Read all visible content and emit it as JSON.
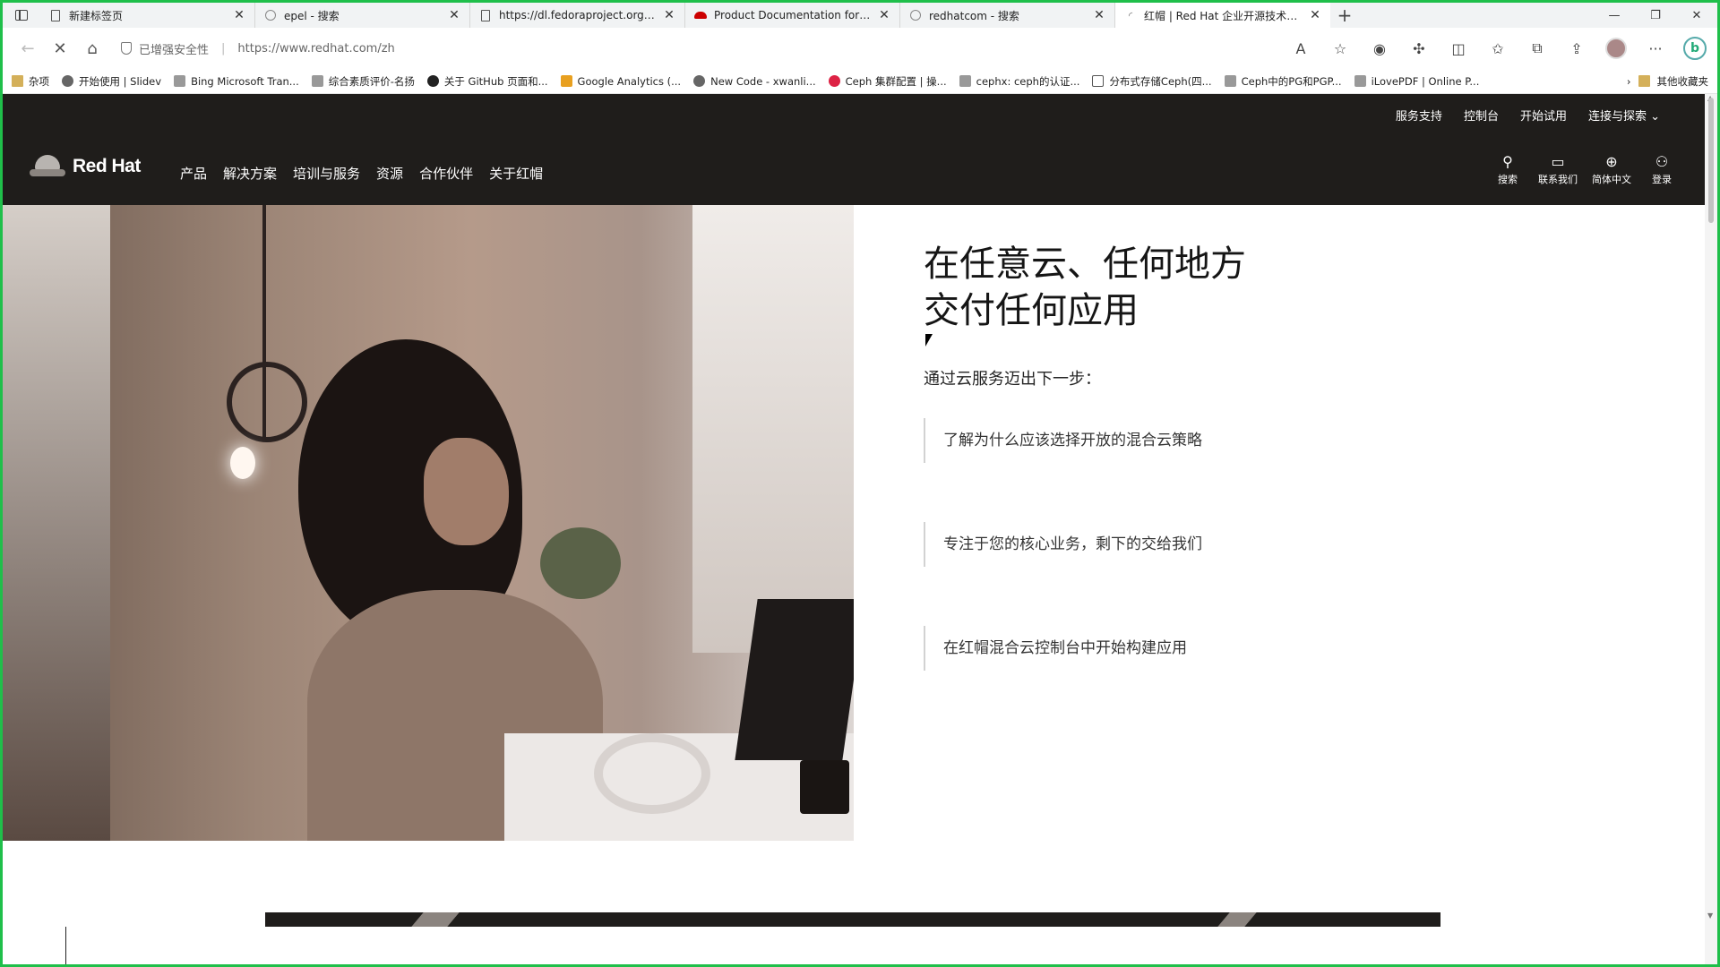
{
  "browser": {
    "tabs": [
      {
        "title": "新建标签页",
        "favicon": "new-tab-icon",
        "active": false
      },
      {
        "title": "epel - 搜索",
        "favicon": "bing-icon",
        "active": false
      },
      {
        "title": "https://dl.fedoraproject.org/pub",
        "favicon": "document-icon",
        "active": false
      },
      {
        "title": "Product Documentation for Red",
        "favicon": "redhat-icon",
        "active": false
      },
      {
        "title": "redhatcom - 搜索",
        "favicon": "bing-icon",
        "active": false
      },
      {
        "title": "红帽 | Red Hat 企业开源技术领导",
        "favicon": "loading-icon",
        "active": true
      }
    ],
    "security_label": "已增强安全性",
    "url": "https://www.redhat.com/zh",
    "bookmarks": [
      {
        "label": "杂项",
        "icon": "folder-icon"
      },
      {
        "label": "开始使用 | Slidev",
        "icon": "slidev-icon"
      },
      {
        "label": "Bing Microsoft Tran...",
        "icon": "translator-icon"
      },
      {
        "label": "综合素质评价-名扬",
        "icon": "site-icon"
      },
      {
        "label": "关于 GitHub 页面和...",
        "icon": "github-icon"
      },
      {
        "label": "Google Analytics (...",
        "icon": "analytics-icon"
      },
      {
        "label": "New Code - xwanli...",
        "icon": "code-icon"
      },
      {
        "label": "Ceph 集群配置 | 操...",
        "icon": "ceph-icon"
      },
      {
        "label": "cephx: ceph的认证...",
        "icon": "link-icon"
      },
      {
        "label": "分布式存储Ceph(四...",
        "icon": "document-icon"
      },
      {
        "label": "Ceph中的PG和PGP...",
        "icon": "site-icon"
      },
      {
        "label": "iLovePDF | Online P...",
        "icon": "pdf-icon"
      }
    ],
    "bookmarks_more": "其他收藏夹"
  },
  "site": {
    "utility_links": [
      "服务支持",
      "控制台",
      "开始试用",
      "连接与探索 ⌄"
    ],
    "logo_text": "Red Hat",
    "nav_items": [
      "产品",
      "解决方案",
      "培训与服务",
      "资源",
      "合作伙伴",
      "关于红帽"
    ],
    "actions": [
      {
        "label": "搜索",
        "icon": "search-icon",
        "glyph": "⚲"
      },
      {
        "label": "联系我们",
        "icon": "chat-icon",
        "glyph": "▭"
      },
      {
        "label": "简体中文",
        "icon": "globe-icon",
        "glyph": "⊕"
      },
      {
        "label": "登录",
        "icon": "user-icon",
        "glyph": "⚇"
      }
    ],
    "hero": {
      "title_line1": "在任意云、任何地方",
      "title_line2": "交付任何应用",
      "subtitle": "通过云服务迈出下一步：",
      "links": [
        "了解为什么应该选择开放的混合云策略",
        "专注于您的核心业务，剩下的交给我们",
        "在红帽混合云控制台中开始构建应用"
      ]
    }
  },
  "colors": {
    "header_bg": "#1f1d1b",
    "frame_border": "#1fbf4a"
  }
}
